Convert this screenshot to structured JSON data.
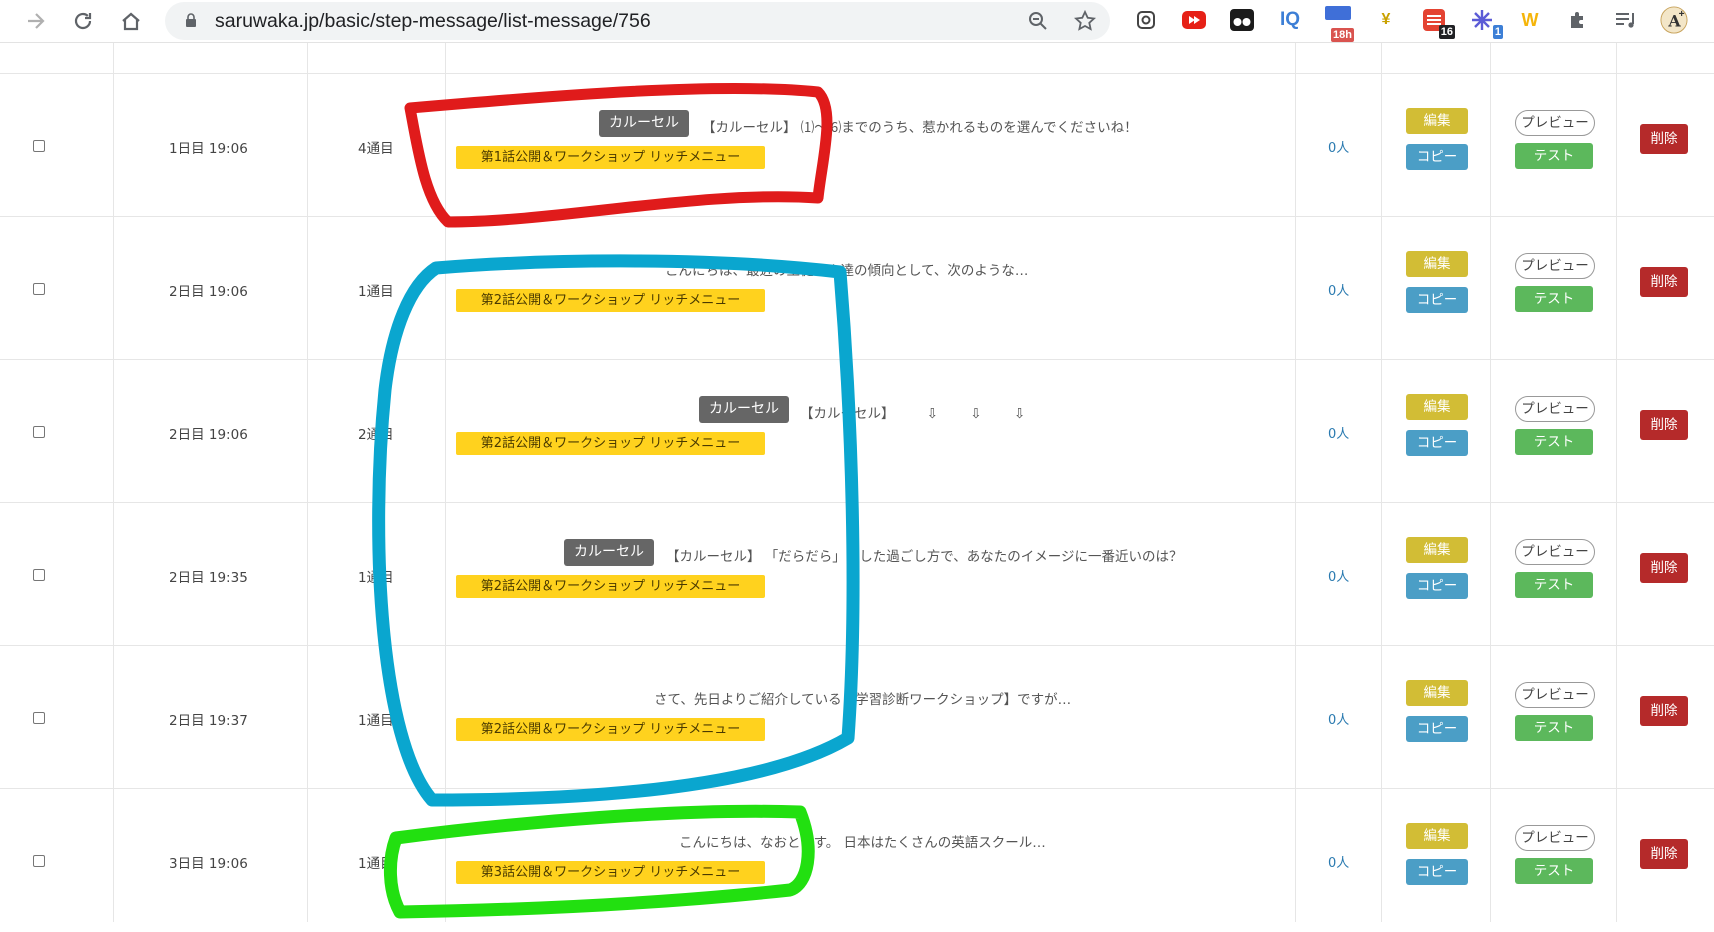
{
  "browser": {
    "url": "saruwaka.jp/basic/step-message/list-message/756",
    "ext_badges": [
      "18h",
      "16",
      "1"
    ],
    "ext_letters": [
      "IQ",
      "W"
    ]
  },
  "rows": [
    {
      "day": "1日目 19:06",
      "num": "4通目",
      "carousel": "カルーセル",
      "message": "【カルーセル】 ⑴〜⑹までのうち、惹かれるものを選んでくださいね！",
      "tag": "第1話公開＆ワークショップ リッチメニュー",
      "count": "0人",
      "edit": "編集",
      "copy": "コピー",
      "preview": "プレビュー",
      "test": "テスト",
      "delete": "削除"
    },
    {
      "day": "2日目 19:06",
      "num": "1通目",
      "carousel": "",
      "message": "こんにちは、最近の生徒さん達の傾向として、次のような…",
      "tag": "第2話公開＆ワークショップ リッチメニュー",
      "count": "0人",
      "edit": "編集",
      "copy": "コピー",
      "preview": "プレビュー",
      "test": "テスト",
      "delete": "削除"
    },
    {
      "day": "2日目 19:06",
      "num": "2通目",
      "carousel": "カルーセル",
      "message": "【カルーセル】 ⇩ ⇩ ⇩",
      "tag": "第2話公開＆ワークショップ リッチメニュー",
      "count": "0人",
      "edit": "編集",
      "copy": "コピー",
      "preview": "プレビュー",
      "test": "テスト",
      "delete": "削除"
    },
    {
      "day": "2日目 19:35",
      "num": "1通目",
      "carousel": "カルーセル",
      "message": "【カルーセル】 「だらだら」とした過ごし方で、あなたのイメージに一番近いのは？",
      "tag": "第2話公開＆ワークショップ リッチメニュー",
      "count": "0人",
      "edit": "編集",
      "copy": "コピー",
      "preview": "プレビュー",
      "test": "テスト",
      "delete": "削除"
    },
    {
      "day": "2日目 19:37",
      "num": "1通目",
      "carousel": "",
      "message": "さて、先日よりご紹介している【学習診断ワークショップ】ですが…",
      "tag": "第2話公開＆ワークショップ リッチメニュー",
      "count": "0人",
      "edit": "編集",
      "copy": "コピー",
      "preview": "プレビュー",
      "test": "テスト",
      "delete": "削除"
    },
    {
      "day": "3日目 19:06",
      "num": "1通目",
      "carousel": "",
      "message": "こんにちは、なおとです。 日本はたくさんの英語スクール…",
      "tag": "第3話公開＆ワークショップ リッチメニュー",
      "count": "0人",
      "edit": "編集",
      "copy": "コピー",
      "preview": "プレビュー",
      "test": "テスト",
      "delete": "削除"
    }
  ],
  "colors": {
    "edit": "#d2bd35",
    "copy": "#4b9ec6",
    "test": "#5cb85c",
    "delete": "#b52a2a",
    "tag": "#ffd21e",
    "annotation_red": "#e01b1b",
    "annotation_blue": "#0aa6cf",
    "annotation_green": "#22e010"
  }
}
